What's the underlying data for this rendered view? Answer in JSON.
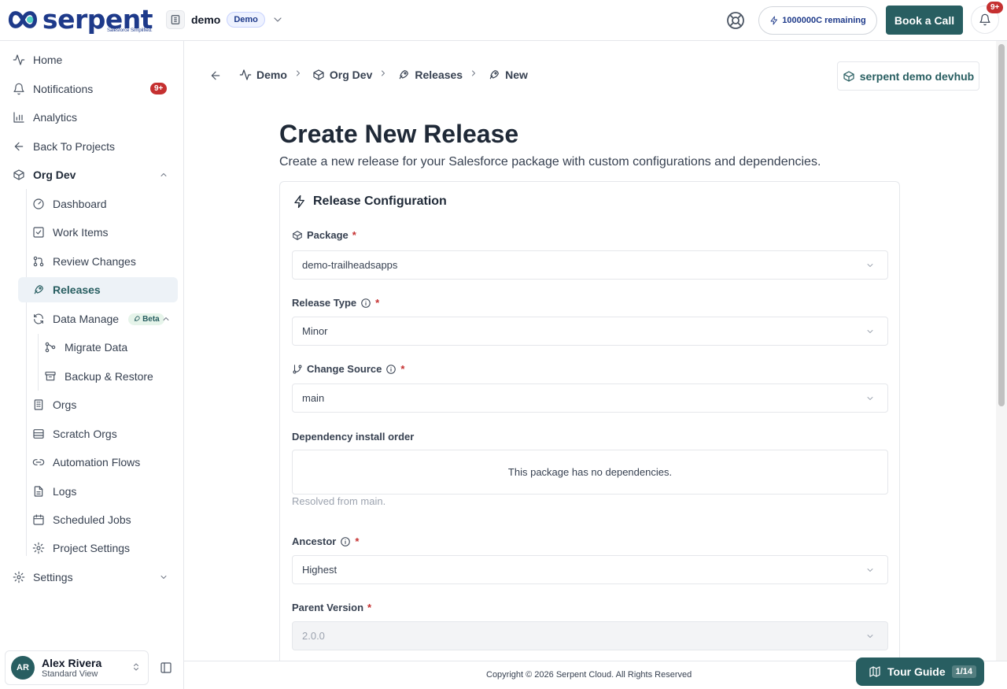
{
  "brand": {
    "name": "serpent",
    "tagline": "Salesforce Simplified."
  },
  "topbar": {
    "project_name": "demo",
    "project_badge": "Demo",
    "credits": "1000000C remaining",
    "book_call": "Book a Call",
    "notif_count": "9+"
  },
  "sidebar": {
    "home": "Home",
    "notifications": "Notifications",
    "notifications_badge": "9+",
    "analytics": "Analytics",
    "back": "Back To Projects",
    "org": "Org Dev",
    "items": {
      "dashboard": "Dashboard",
      "work_items": "Work Items",
      "review_changes": "Review Changes",
      "releases": "Releases",
      "data_management": "Data Manage",
      "beta": "Beta",
      "migrate_data": "Migrate Data",
      "backup_restore": "Backup & Restore",
      "orgs": "Orgs",
      "scratch_orgs": "Scratch Orgs",
      "automation_flows": "Automation Flows",
      "logs": "Logs",
      "scheduled_jobs": "Scheduled Jobs",
      "project_settings": "Project Settings"
    },
    "settings": "Settings",
    "user": {
      "initials": "AR",
      "name": "Alex Rivera",
      "role": "Standard View"
    }
  },
  "breadcrumb": [
    "Demo",
    "Org Dev",
    "Releases",
    "New"
  ],
  "devhub": "serpent demo devhub",
  "page": {
    "title": "Create New Release",
    "subtitle": "Create a new release for your Salesforce package with custom configurations and dependencies."
  },
  "form": {
    "section_title": "Release Configuration",
    "package_label": "Package",
    "package_value": "demo-trailheadsapps",
    "release_type_label": "Release Type",
    "release_type_value": "Minor",
    "change_source_label": "Change Source",
    "change_source_value": "main",
    "dependency_label": "Dependency install order",
    "dependency_empty": "This package has no dependencies.",
    "dependency_helper": "Resolved from main.",
    "ancestor_label": "Ancestor",
    "ancestor_value": "Highest",
    "parent_version_label": "Parent Version",
    "parent_version_value": "2.0.0",
    "required_marker": "*"
  },
  "footer": {
    "copyright": "Copyright © 2026 Serpent Cloud. All Rights Reserved",
    "tour_label": "Tour Guide",
    "tour_count": "1/14"
  },
  "colors": {
    "brand": "#1e3a8a",
    "accent": "#285e61",
    "danger": "#c53030"
  }
}
